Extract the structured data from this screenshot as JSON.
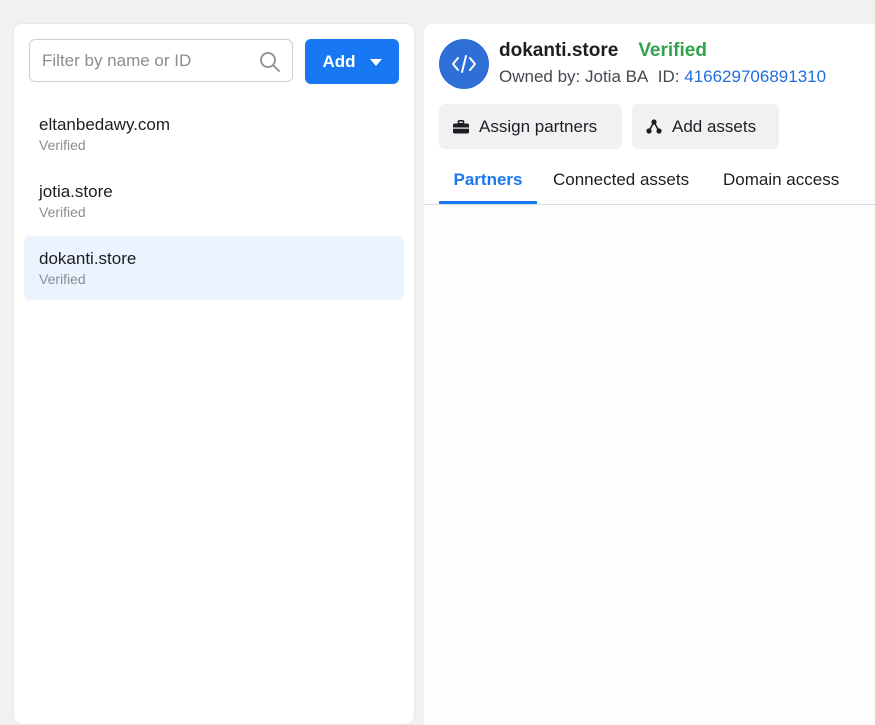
{
  "sidebar": {
    "search": {
      "placeholder": "Filter by name or ID",
      "value": ""
    },
    "add_button": {
      "label": "Add"
    },
    "domains": [
      {
        "name": "eltanbedawy.com",
        "status": "Verified",
        "selected": false
      },
      {
        "name": "jotia.store",
        "status": "Verified",
        "selected": false
      },
      {
        "name": "dokanti.store",
        "status": "Verified",
        "selected": true
      }
    ]
  },
  "detail": {
    "title": "dokanti.store",
    "status": "Verified",
    "owned_by_label": "Owned by:",
    "owner": "Jotia BA",
    "id_label": "ID:",
    "id_value": "416629706891310",
    "buttons": {
      "assign_partners": "Assign partners",
      "add_assets": "Add assets"
    },
    "tabs": [
      {
        "label": "Partners",
        "active": true
      },
      {
        "label": "Connected assets",
        "active": false
      },
      {
        "label": "Domain access",
        "active": false
      }
    ]
  },
  "colors": {
    "accent": "#1877f2",
    "verified": "#31a24c",
    "avatar": "#2d6fd6",
    "selected_row": "#ebf3ff"
  },
  "icons": {
    "search": "search-icon",
    "caret": "caret-down-icon",
    "domain": "code-icon",
    "assign": "briefcase-icon",
    "assets": "nodes-icon"
  }
}
